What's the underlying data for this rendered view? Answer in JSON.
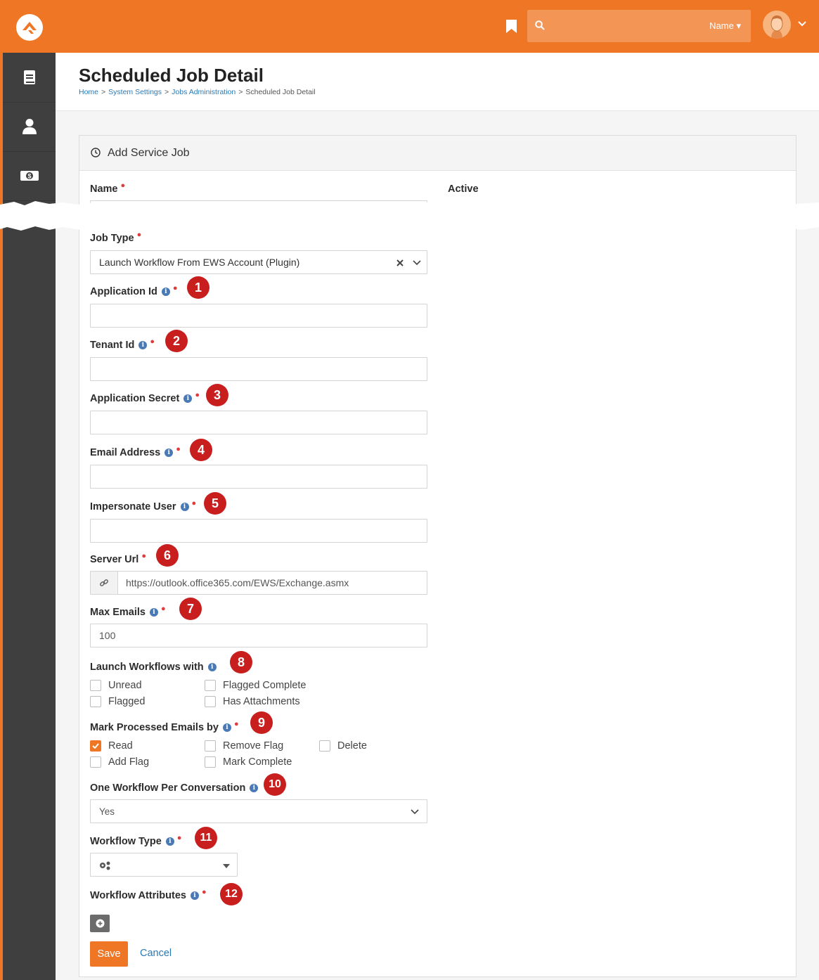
{
  "header": {
    "search_placeholder": "",
    "search_filter": "Name ▾"
  },
  "page": {
    "title": "Scheduled Job Detail",
    "breadcrumb": [
      "Home",
      "System Settings",
      "Jobs Administration",
      "Scheduled Job Detail"
    ]
  },
  "panel": {
    "title": "Add Service Job",
    "name_label": "Name",
    "active_label": "Active"
  },
  "fields": {
    "job_type": {
      "label": "Job Type",
      "value": "Launch Workflow From EWS Account (Plugin)"
    },
    "application_id": {
      "label": "Application Id",
      "badge": "1",
      "value": ""
    },
    "tenant_id": {
      "label": "Tenant Id",
      "badge": "2",
      "value": ""
    },
    "application_secret": {
      "label": "Application Secret",
      "badge": "3",
      "value": ""
    },
    "email_address": {
      "label": "Email Address",
      "badge": "4",
      "value": ""
    },
    "impersonate_user": {
      "label": "Impersonate User",
      "badge": "5",
      "value": ""
    },
    "server_url": {
      "label": "Server Url",
      "badge": "6",
      "value": "https://outlook.office365.com/EWS/Exchange.asmx"
    },
    "max_emails": {
      "label": "Max Emails",
      "badge": "7",
      "value": "100"
    },
    "launch_workflows_with": {
      "label": "Launch Workflows with",
      "badge": "8",
      "options": [
        {
          "label": "Unread",
          "checked": false
        },
        {
          "label": "Flagged Complete",
          "checked": false
        },
        {
          "label": "Flagged",
          "checked": false
        },
        {
          "label": "Has Attachments",
          "checked": false
        }
      ]
    },
    "mark_processed": {
      "label": "Mark Processed Emails by",
      "badge": "9",
      "options": [
        {
          "label": "Read",
          "checked": true
        },
        {
          "label": "Remove Flag",
          "checked": false
        },
        {
          "label": "Delete",
          "checked": false
        },
        {
          "label": "Add Flag",
          "checked": false
        },
        {
          "label": "Mark Complete",
          "checked": false
        }
      ]
    },
    "one_workflow_per_conversation": {
      "label": "One Workflow Per Conversation",
      "badge": "10",
      "value": "Yes"
    },
    "workflow_type": {
      "label": "Workflow Type",
      "badge": "11"
    },
    "workflow_attributes": {
      "label": "Workflow Attributes",
      "badge": "12"
    }
  },
  "actions": {
    "save": "Save",
    "cancel": "Cancel"
  },
  "colors": {
    "brand": "#ee7625",
    "sidebar": "#3f3f3f",
    "link": "#2a7ab8",
    "badge": "#c81e1e",
    "required": "#e03c3c"
  }
}
